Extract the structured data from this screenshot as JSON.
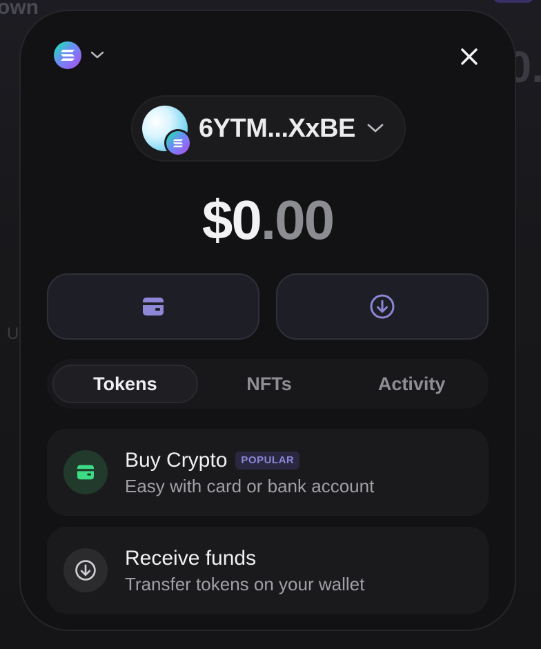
{
  "background": {
    "top_text": "own",
    "right_text": "0.",
    "left_text": "U"
  },
  "header": {
    "network_icon": "solana-icon",
    "network_dropdown_icon": "chevron-down-icon",
    "close_icon": "close-icon"
  },
  "account": {
    "address": "6YTM...XxBE",
    "avatar_icon": "avatar",
    "badge_icon": "solana-icon"
  },
  "balance": {
    "integer": "$0",
    "decimal": ".00"
  },
  "actions": {
    "buy_icon": "wallet-card-icon",
    "receive_icon": "arrow-down-circle-icon"
  },
  "tabs": [
    {
      "label": "Tokens",
      "active": true
    },
    {
      "label": "NFTs",
      "active": false
    },
    {
      "label": "Activity",
      "active": false
    }
  ],
  "cards": {
    "buy": {
      "title": "Buy Crypto",
      "badge": "POPULAR",
      "subtitle": "Easy with card or bank account",
      "icon": "wallet-card-icon"
    },
    "receive": {
      "title": "Receive funds",
      "subtitle": "Transfer tokens on your wallet",
      "icon": "arrow-down-circle-icon"
    }
  },
  "colors": {
    "accent_purple": "#8e86d6",
    "buy_icon_green": "#3ddc84",
    "modal_bg": "#121214"
  }
}
